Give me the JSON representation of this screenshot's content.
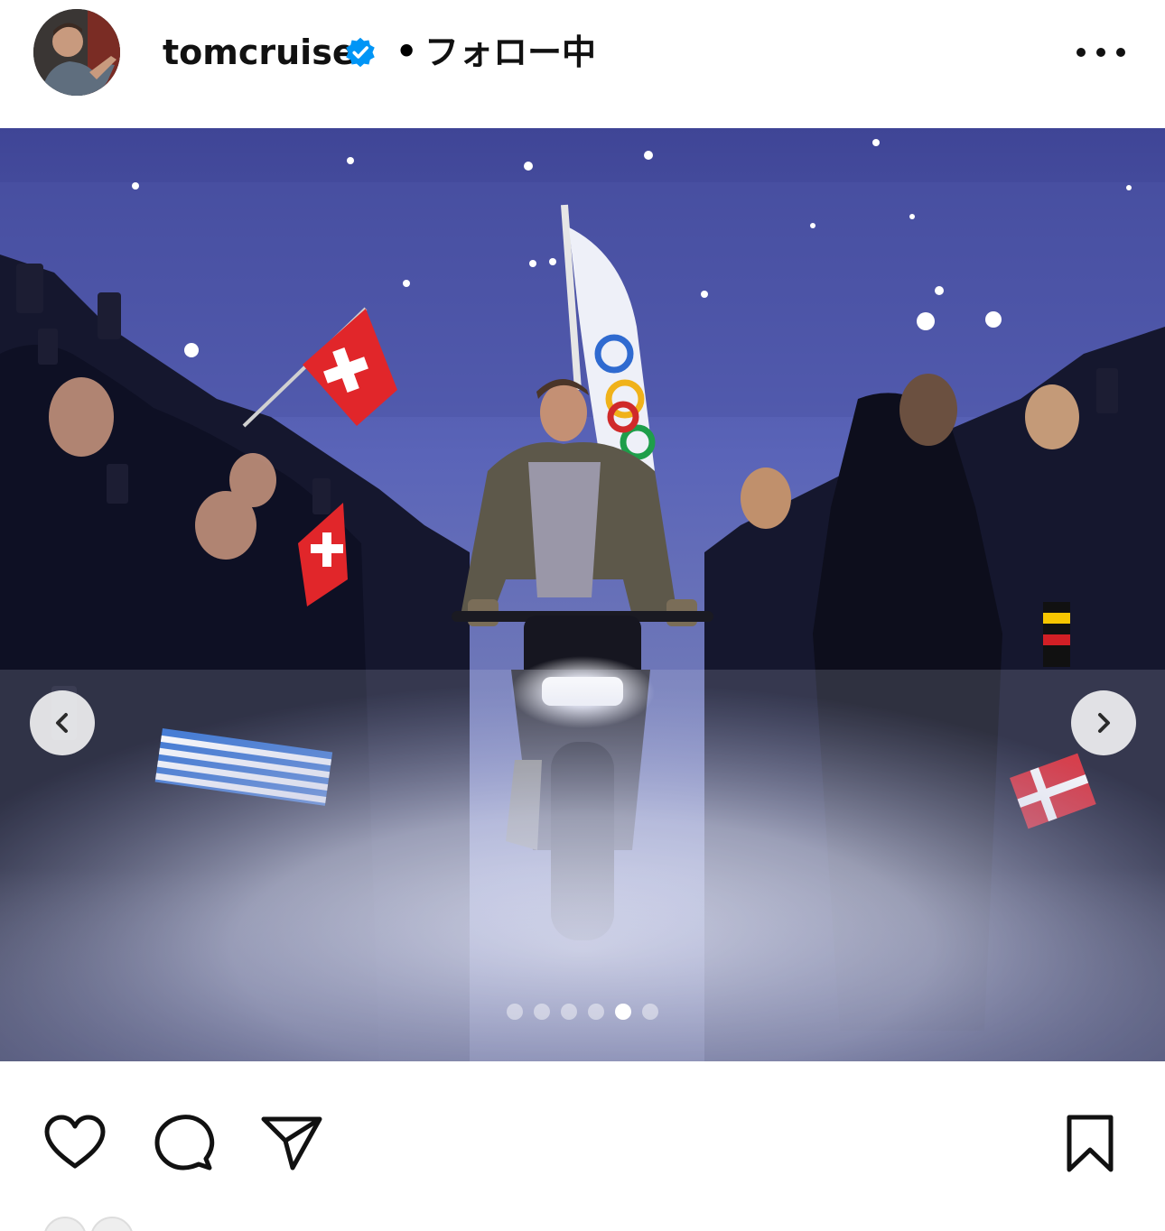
{
  "post": {
    "username": "tomcruise",
    "separator": "•",
    "follow_status": "フォロー中",
    "verified": true
  },
  "icons": {
    "verified": "verified-badge-icon",
    "more": "more-options-icon",
    "prev": "chevron-left-icon",
    "next": "chevron-right-icon",
    "like": "heart-icon",
    "comment": "comment-bubble-icon",
    "share": "paper-plane-icon",
    "save": "bookmark-icon"
  },
  "carousel": {
    "total_slides": 6,
    "active_index": 4
  },
  "colors": {
    "verified_blue": "#0095f6",
    "text": "#111111",
    "background": "#ffffff"
  }
}
